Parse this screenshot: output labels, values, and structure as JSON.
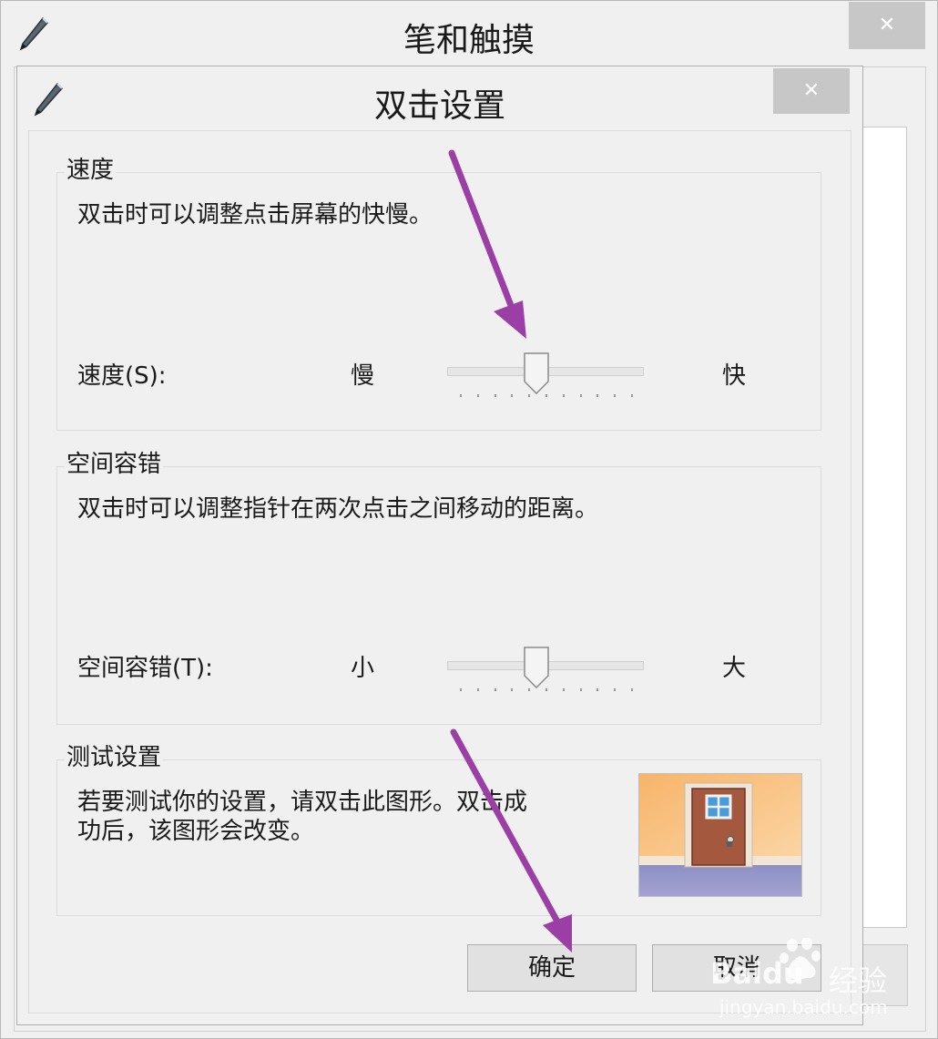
{
  "outer_window": {
    "title": "笔和触摸",
    "close_label": "✕"
  },
  "dialog": {
    "title": "双击设置",
    "close_label": "✕",
    "speed": {
      "group_title": "速度",
      "description": "双击时可以调整点击屏幕的快慢。",
      "slider_label": "速度(S):",
      "min_label": "慢",
      "max_label": "快",
      "value_fraction": 0.45
    },
    "tolerance": {
      "group_title": "空间容错",
      "description": "双击时可以调整指针在两次点击之间移动的距离。",
      "slider_label": "空间容错(T):",
      "min_label": "小",
      "max_label": "大",
      "value_fraction": 0.45
    },
    "test": {
      "group_title": "测试设置",
      "description_line1": "若要测试你的设置，请双击此图形。双击成",
      "description_line2": "功后，该图形会改变。"
    },
    "buttons": {
      "ok": "确定",
      "cancel": "取消"
    }
  },
  "watermark": {
    "brand": "Baidu",
    "suffix": "经验",
    "url": "jingyan.baidu.com"
  },
  "colors": {
    "annotation_arrow": "#9b3fa6",
    "window_bg": "#f0f0f0",
    "close_button": "#c7c7c7"
  }
}
